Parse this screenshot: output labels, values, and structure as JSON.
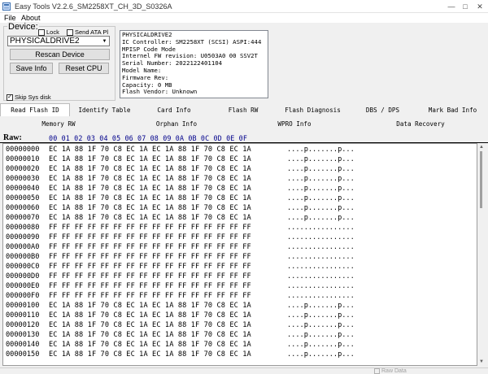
{
  "window": {
    "title": "Easy Tools V2.2.6_SM2258XT_CH_3D_S0326A"
  },
  "menu": [
    "File",
    "About"
  ],
  "device": {
    "label": "Device:",
    "lock_label": "Lock",
    "send_ata_label": "Send ATA Pl",
    "drive_selected": "PHYSICALDRIVE2",
    "rescan_label": "Rescan Device",
    "save_info_label": "Save Info",
    "reset_cpu_label": "Reset CPU",
    "skip_sys_disk_label": "Skip Sys disk",
    "skip_sys_disk_checked": true
  },
  "info_lines": [
    "PHYSICALDRIVE2",
    "IC Controller: SM2258XT (SCSI) ASPI:444",
    "MPISP Code Mode",
    "Internel FW revision: U0503A0 00 SSV2T",
    "Serial Number: 2022122401104",
    "Model Name:",
    "Firmware Rev:",
    "Capacity: 0 MB",
    "Flash Vendor: Unknown"
  ],
  "tabs_row1": [
    "Read Flash ID",
    "Identify Table",
    "Card Info",
    "Flash RW",
    "Flash Diagnosis",
    "DBS / DPS",
    "Mark Bad Info"
  ],
  "active_tab": "Read Flash ID",
  "tabs_row2": [
    "Memory RW",
    "Orphan Info",
    "WPRO Info",
    "Data Recovery"
  ],
  "raw": {
    "label": "Raw:",
    "header": "00 01 02 03 04 05 06 07 08 09 0A 0B 0C 0D 0E 0F",
    "rows": [
      {
        "addr": "00000000",
        "bytes": "EC 1A 88 1F 70 C8 EC 1A EC 1A 88 1F 70 C8 EC 1A",
        "ascii": "....p.......p..."
      },
      {
        "addr": "00000010",
        "bytes": "EC 1A 88 1F 70 C8 EC 1A EC 1A 88 1F 70 C8 EC 1A",
        "ascii": "....p.......p..."
      },
      {
        "addr": "00000020",
        "bytes": "EC 1A 88 1F 70 C8 EC 1A EC 1A 88 1F 70 C8 EC 1A",
        "ascii": "....p.......p..."
      },
      {
        "addr": "00000030",
        "bytes": "EC 1A 88 1F 70 C8 EC 1A EC 1A 88 1F 70 C8 EC 1A",
        "ascii": "....p.......p..."
      },
      {
        "addr": "00000040",
        "bytes": "EC 1A 88 1F 70 C8 EC 1A EC 1A 88 1F 70 C8 EC 1A",
        "ascii": "....p.......p..."
      },
      {
        "addr": "00000050",
        "bytes": "EC 1A 88 1F 70 C8 EC 1A EC 1A 88 1F 70 C8 EC 1A",
        "ascii": "....p.......p..."
      },
      {
        "addr": "00000060",
        "bytes": "EC 1A 88 1F 70 C8 EC 1A EC 1A 88 1F 70 C8 EC 1A",
        "ascii": "....p.......p..."
      },
      {
        "addr": "00000070",
        "bytes": "EC 1A 88 1F 70 C8 EC 1A EC 1A 88 1F 70 C8 EC 1A",
        "ascii": "....p.......p..."
      },
      {
        "addr": "00000080",
        "bytes": "FF FF FF FF FF FF FF FF FF FF FF FF FF FF FF FF",
        "ascii": "................"
      },
      {
        "addr": "00000090",
        "bytes": "FF FF FF FF FF FF FF FF FF FF FF FF FF FF FF FF",
        "ascii": "................"
      },
      {
        "addr": "000000A0",
        "bytes": "FF FF FF FF FF FF FF FF FF FF FF FF FF FF FF FF",
        "ascii": "................"
      },
      {
        "addr": "000000B0",
        "bytes": "FF FF FF FF FF FF FF FF FF FF FF FF FF FF FF FF",
        "ascii": "................"
      },
      {
        "addr": "000000C0",
        "bytes": "FF FF FF FF FF FF FF FF FF FF FF FF FF FF FF FF",
        "ascii": "................"
      },
      {
        "addr": "000000D0",
        "bytes": "FF FF FF FF FF FF FF FF FF FF FF FF FF FF FF FF",
        "ascii": "................"
      },
      {
        "addr": "000000E0",
        "bytes": "FF FF FF FF FF FF FF FF FF FF FF FF FF FF FF FF",
        "ascii": "................"
      },
      {
        "addr": "000000F0",
        "bytes": "FF FF FF FF FF FF FF FF FF FF FF FF FF FF FF FF",
        "ascii": "................"
      },
      {
        "addr": "00000100",
        "bytes": "EC 1A 88 1F 70 C8 EC 1A EC 1A 88 1F 70 C8 EC 1A",
        "ascii": "....p.......p..."
      },
      {
        "addr": "00000110",
        "bytes": "EC 1A 88 1F 70 C8 EC 1A EC 1A 88 1F 70 C8 EC 1A",
        "ascii": "....p.......p..."
      },
      {
        "addr": "00000120",
        "bytes": "EC 1A 88 1F 70 C8 EC 1A EC 1A 88 1F 70 C8 EC 1A",
        "ascii": "....p.......p..."
      },
      {
        "addr": "00000130",
        "bytes": "EC 1A 88 1F 70 C8 EC 1A EC 1A 88 1F 70 C8 EC 1A",
        "ascii": "....p.......p..."
      },
      {
        "addr": "00000140",
        "bytes": "EC 1A 88 1F 70 C8 EC 1A EC 1A 88 1F 70 C8 EC 1A",
        "ascii": "....p.......p..."
      },
      {
        "addr": "00000150",
        "bytes": "EC 1A 88 1F 70 C8 EC 1A EC 1A 88 1F 70 C8 EC 1A",
        "ascii": "....p.......p..."
      }
    ]
  },
  "status": {
    "raw_data_label": "Raw Data"
  }
}
